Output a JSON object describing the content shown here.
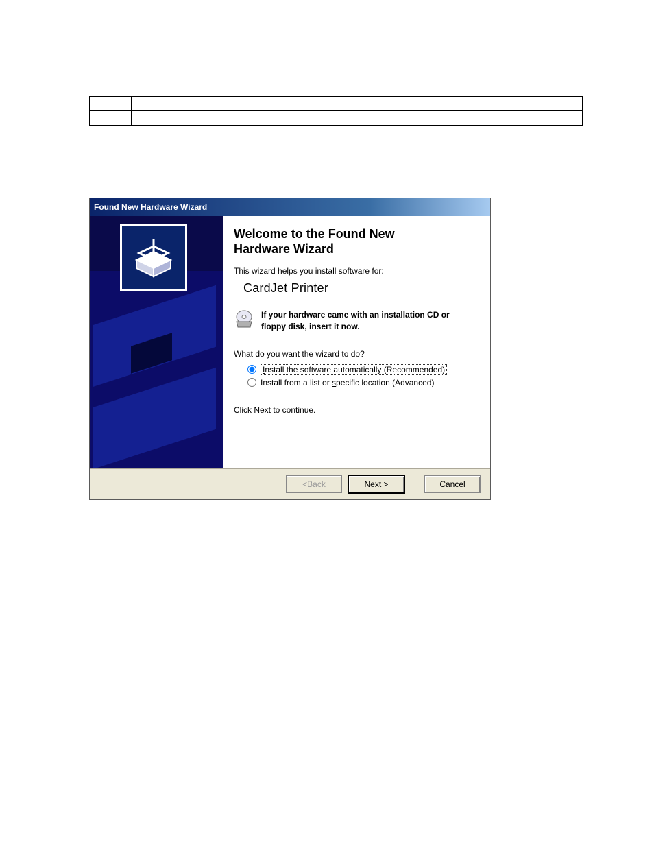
{
  "table": {
    "rows": [
      {
        "cells": [
          "",
          ""
        ]
      },
      {
        "cells": [
          "",
          ""
        ]
      }
    ]
  },
  "wizard": {
    "title": "Found New Hardware Wizard",
    "heading_line1": "Welcome to the Found New",
    "heading_line2": "Hardware Wizard",
    "intro": "This wizard helps you install software for:",
    "device_name": "CardJet Printer",
    "cd_message": "If your hardware came with an installation CD or floppy disk, insert it now.",
    "prompt": "What do you want the wizard to do?",
    "option_auto_pre": "I",
    "option_auto_rest": "nstall the software automatically (Recommended)",
    "option_list_pre": "Install from a list or ",
    "option_list_u": "s",
    "option_list_post": "pecific location (Advanced)",
    "selected_option": "auto",
    "click_next": "Click Next to continue.",
    "buttons": {
      "back_pre": "< ",
      "back_u": "B",
      "back_post": "ack",
      "next_u": "N",
      "next_post": "ext >",
      "cancel": "Cancel"
    }
  }
}
